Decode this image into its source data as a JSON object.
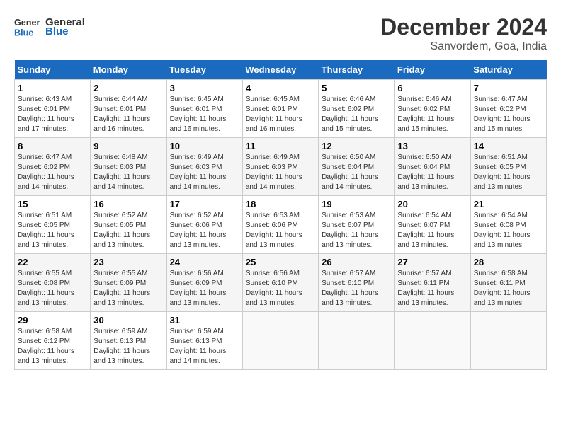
{
  "header": {
    "logo_line1": "General",
    "logo_line2": "Blue",
    "month": "December 2024",
    "location": "Sanvordem, Goa, India"
  },
  "weekdays": [
    "Sunday",
    "Monday",
    "Tuesday",
    "Wednesday",
    "Thursday",
    "Friday",
    "Saturday"
  ],
  "weeks": [
    [
      {
        "day": "1",
        "sunrise": "6:43 AM",
        "sunset": "6:01 PM",
        "daylight": "11 hours and 17 minutes."
      },
      {
        "day": "2",
        "sunrise": "6:44 AM",
        "sunset": "6:01 PM",
        "daylight": "11 hours and 16 minutes."
      },
      {
        "day": "3",
        "sunrise": "6:45 AM",
        "sunset": "6:01 PM",
        "daylight": "11 hours and 16 minutes."
      },
      {
        "day": "4",
        "sunrise": "6:45 AM",
        "sunset": "6:01 PM",
        "daylight": "11 hours and 16 minutes."
      },
      {
        "day": "5",
        "sunrise": "6:46 AM",
        "sunset": "6:02 PM",
        "daylight": "11 hours and 15 minutes."
      },
      {
        "day": "6",
        "sunrise": "6:46 AM",
        "sunset": "6:02 PM",
        "daylight": "11 hours and 15 minutes."
      },
      {
        "day": "7",
        "sunrise": "6:47 AM",
        "sunset": "6:02 PM",
        "daylight": "11 hours and 15 minutes."
      }
    ],
    [
      {
        "day": "8",
        "sunrise": "6:47 AM",
        "sunset": "6:02 PM",
        "daylight": "11 hours and 14 minutes."
      },
      {
        "day": "9",
        "sunrise": "6:48 AM",
        "sunset": "6:03 PM",
        "daylight": "11 hours and 14 minutes."
      },
      {
        "day": "10",
        "sunrise": "6:49 AM",
        "sunset": "6:03 PM",
        "daylight": "11 hours and 14 minutes."
      },
      {
        "day": "11",
        "sunrise": "6:49 AM",
        "sunset": "6:03 PM",
        "daylight": "11 hours and 14 minutes."
      },
      {
        "day": "12",
        "sunrise": "6:50 AM",
        "sunset": "6:04 PM",
        "daylight": "11 hours and 14 minutes."
      },
      {
        "day": "13",
        "sunrise": "6:50 AM",
        "sunset": "6:04 PM",
        "daylight": "11 hours and 13 minutes."
      },
      {
        "day": "14",
        "sunrise": "6:51 AM",
        "sunset": "6:05 PM",
        "daylight": "11 hours and 13 minutes."
      }
    ],
    [
      {
        "day": "15",
        "sunrise": "6:51 AM",
        "sunset": "6:05 PM",
        "daylight": "11 hours and 13 minutes."
      },
      {
        "day": "16",
        "sunrise": "6:52 AM",
        "sunset": "6:05 PM",
        "daylight": "11 hours and 13 minutes."
      },
      {
        "day": "17",
        "sunrise": "6:52 AM",
        "sunset": "6:06 PM",
        "daylight": "11 hours and 13 minutes."
      },
      {
        "day": "18",
        "sunrise": "6:53 AM",
        "sunset": "6:06 PM",
        "daylight": "11 hours and 13 minutes."
      },
      {
        "day": "19",
        "sunrise": "6:53 AM",
        "sunset": "6:07 PM",
        "daylight": "11 hours and 13 minutes."
      },
      {
        "day": "20",
        "sunrise": "6:54 AM",
        "sunset": "6:07 PM",
        "daylight": "11 hours and 13 minutes."
      },
      {
        "day": "21",
        "sunrise": "6:54 AM",
        "sunset": "6:08 PM",
        "daylight": "11 hours and 13 minutes."
      }
    ],
    [
      {
        "day": "22",
        "sunrise": "6:55 AM",
        "sunset": "6:08 PM",
        "daylight": "11 hours and 13 minutes."
      },
      {
        "day": "23",
        "sunrise": "6:55 AM",
        "sunset": "6:09 PM",
        "daylight": "11 hours and 13 minutes."
      },
      {
        "day": "24",
        "sunrise": "6:56 AM",
        "sunset": "6:09 PM",
        "daylight": "11 hours and 13 minutes."
      },
      {
        "day": "25",
        "sunrise": "6:56 AM",
        "sunset": "6:10 PM",
        "daylight": "11 hours and 13 minutes."
      },
      {
        "day": "26",
        "sunrise": "6:57 AM",
        "sunset": "6:10 PM",
        "daylight": "11 hours and 13 minutes."
      },
      {
        "day": "27",
        "sunrise": "6:57 AM",
        "sunset": "6:11 PM",
        "daylight": "11 hours and 13 minutes."
      },
      {
        "day": "28",
        "sunrise": "6:58 AM",
        "sunset": "6:11 PM",
        "daylight": "11 hours and 13 minutes."
      }
    ],
    [
      {
        "day": "29",
        "sunrise": "6:58 AM",
        "sunset": "6:12 PM",
        "daylight": "11 hours and 13 minutes."
      },
      {
        "day": "30",
        "sunrise": "6:59 AM",
        "sunset": "6:13 PM",
        "daylight": "11 hours and 13 minutes."
      },
      {
        "day": "31",
        "sunrise": "6:59 AM",
        "sunset": "6:13 PM",
        "daylight": "11 hours and 14 minutes."
      },
      null,
      null,
      null,
      null
    ]
  ],
  "labels": {
    "sunrise": "Sunrise:",
    "sunset": "Sunset:",
    "daylight": "Daylight:"
  }
}
